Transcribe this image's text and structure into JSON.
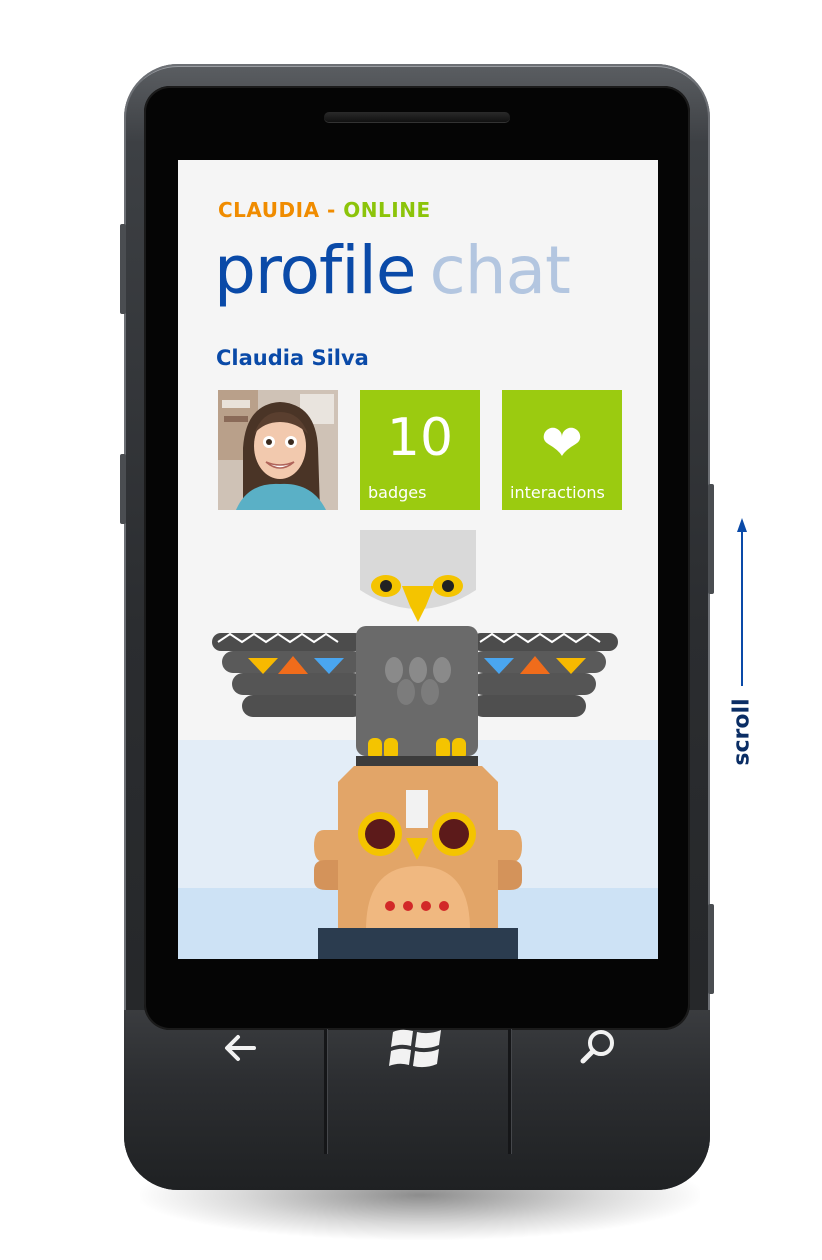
{
  "header": {
    "contact_name_caps": "CLAUDIA",
    "separator": " - ",
    "presence": "ONLINE"
  },
  "pivot": {
    "active": "profile",
    "inactive": "chat"
  },
  "profile": {
    "full_name": "Claudia Silva"
  },
  "tiles": {
    "badges_count": "10",
    "badges_label": "badges",
    "interactions_label": "interactions"
  },
  "annotation": {
    "scroll_label": "scroll"
  },
  "colors": {
    "accent_blue": "#0a4aa8",
    "accent_orange": "#f08c00",
    "accent_green": "#8cc40a",
    "tile_green": "#9bcb10",
    "pivot_inactive": "#b3c6e0"
  },
  "icons": {
    "interactions": "heart-icon",
    "back": "back-arrow-icon",
    "start": "windows-logo-icon",
    "search": "search-icon"
  }
}
